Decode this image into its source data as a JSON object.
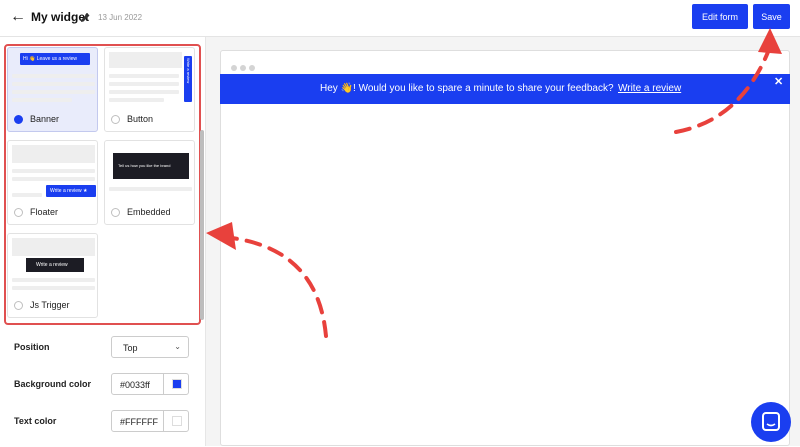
{
  "header": {
    "back_icon": "←",
    "title": "My widget",
    "date": "13 Jun 2022",
    "edit_label": "Edit form",
    "save_label": "Save"
  },
  "widget_types": [
    {
      "label": "Banner",
      "selected": true,
      "preview_text": "Hi 👋 Leave us a review"
    },
    {
      "label": "Button",
      "selected": false,
      "preview_text": "Write a review"
    },
    {
      "label": "Floater",
      "selected": false,
      "preview_text": "Write a review ★"
    },
    {
      "label": "Embedded",
      "selected": false,
      "preview_text": "Tell us how you like the brand"
    },
    {
      "label": "Js Trigger",
      "selected": false,
      "preview_text": "Write a review"
    }
  ],
  "properties": {
    "position": {
      "label": "Position",
      "value": "Top"
    },
    "background_color": {
      "label": "Background color",
      "value": "#0033ff",
      "swatch": "#1a3ef0"
    },
    "text_color": {
      "label": "Text color",
      "value": "#FFFFFF",
      "swatch": "#ffffff"
    }
  },
  "preview": {
    "banner_text": "Hey 👋! Would you like to spare a minute to share your feedback?",
    "banner_link": "Write a review",
    "close_icon": "✕"
  },
  "colors": {
    "accent": "#1a3ef0",
    "annotation": "#e8413c"
  }
}
